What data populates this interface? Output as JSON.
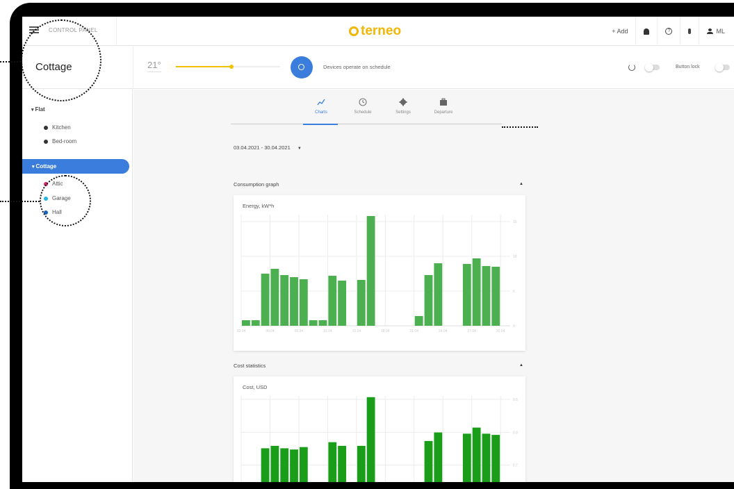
{
  "topbar": {
    "control_panel_label": "CONTROL PANEL",
    "logo_text": "terneo",
    "add_label": "+ Add",
    "user_initials": "ML"
  },
  "subbar": {
    "location_title": "Cottage",
    "temperature": "21°",
    "slider_level_percent": 53,
    "schedule_text": "Devices operate on schedule",
    "button_lock_label": "Button lock"
  },
  "sidebar": {
    "groups": [
      {
        "label": "Flat",
        "rooms": [
          {
            "label": "Kitchen",
            "color": "#333333"
          },
          {
            "label": "Bed-room",
            "color": "#333333"
          }
        ]
      },
      {
        "label": "Cottage",
        "active": true,
        "rooms": [
          {
            "label": "Attic",
            "color": "#d6246e"
          },
          {
            "label": "Garage",
            "color": "#23b7e5"
          },
          {
            "label": "Hall",
            "color": "#1565c0"
          }
        ]
      }
    ]
  },
  "tabs": [
    {
      "label": "Charts",
      "icon": "chart-line-icon",
      "active": true
    },
    {
      "label": "Schedule",
      "icon": "clock-icon"
    },
    {
      "label": "Settings",
      "icon": "gear-icon"
    },
    {
      "label": "Departure",
      "icon": "suitcase-icon"
    }
  ],
  "date_range": "03.04.2021 - 30.04.2021",
  "sections": {
    "consumption_title": "Consumption graph",
    "cost_title": "Cost statistics"
  },
  "colors": {
    "accent": "#3b7ddd",
    "brand": "#f2b705",
    "energy_bar": "#4caf50",
    "cost_bar": "#1a9e1a"
  },
  "chart_data": [
    {
      "type": "bar",
      "title": "Energy, kW*h",
      "x": [
        "03.04",
        "04.04",
        "05.04",
        "06.04",
        "07.04",
        "08.04",
        "09.04",
        "10.04",
        "11.04",
        "12.04",
        "13.04",
        "14.04",
        "15.04",
        "16.04",
        "17.04",
        "18.04",
        "19.04",
        "20.04",
        "21.04",
        "22.04",
        "23.04",
        "24.04",
        "25.04",
        "26.04",
        "27.04",
        "28.04",
        "29.04",
        "30.04"
      ],
      "x_tick_labels": [
        "03.04",
        "06.04",
        "09.04",
        "12.04",
        "15.04",
        "18.04",
        "21.04",
        "24.04",
        "27.04",
        "30.04"
      ],
      "values": [
        0.8,
        0.8,
        7.5,
        8.2,
        7.3,
        7.0,
        6.7,
        0.8,
        0.8,
        7.2,
        6.5,
        0,
        6.6,
        15.8,
        0,
        0,
        0,
        0,
        1.4,
        7.3,
        9.0,
        0,
        0,
        8.9,
        9.7,
        8.6,
        8.5,
        0
      ],
      "y_ticks": [
        0,
        5,
        10,
        15
      ],
      "ylim": [
        0,
        16
      ],
      "grid": true
    },
    {
      "type": "bar",
      "title": "Cost, USD",
      "values": [
        0,
        0,
        1.9,
        2.0,
        1.9,
        1.85,
        1.95,
        0,
        0,
        2.15,
        2.0,
        0,
        2.0,
        4.0,
        0,
        0,
        0,
        0,
        0,
        2.2,
        2.55,
        0,
        0,
        2.5,
        2.75,
        2.5,
        2.45,
        0
      ],
      "y_ticks": [
        0.5,
        0.8,
        0.7
      ],
      "ylim": [
        0,
        4.05
      ],
      "grid": true
    }
  ]
}
